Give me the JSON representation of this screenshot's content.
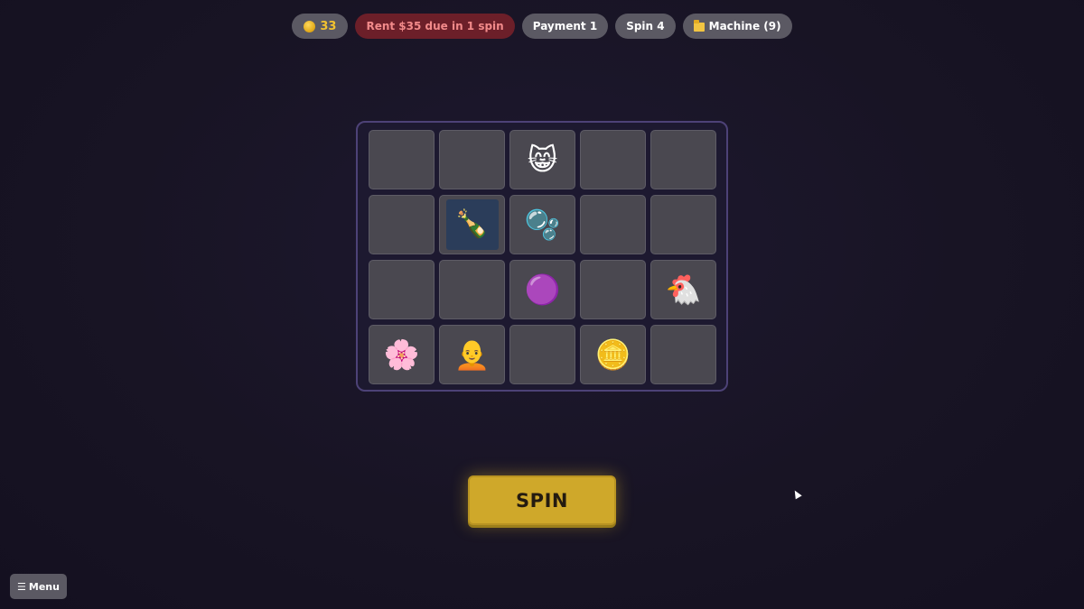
{
  "status": {
    "coins": "33",
    "rent": "Rent $35 due in 1 spin",
    "payment": "Payment 1",
    "spin": "Spin 4",
    "machine": "Machine (9)"
  },
  "icons": {
    "coin": "coin-icon",
    "folder": "folder-icon",
    "menu": "hamburger-icon"
  },
  "colors": {
    "coin_text": "#f2c230",
    "rent_bg": "#6c1f29",
    "rent_text": "#f28a8a",
    "spin_button": "#cfa82a",
    "board_border": "#4d4277"
  },
  "grid": [
    [
      "",
      "",
      "😸",
      "",
      ""
    ],
    [
      "",
      "🍾",
      "🫧",
      "",
      ""
    ],
    [
      "",
      "",
      "🟣",
      "",
      "🐔"
    ],
    [
      "🌸",
      "🧑‍🦲",
      "",
      "🪙",
      ""
    ]
  ],
  "grid_names": [
    [
      "empty",
      "empty",
      "cat",
      "empty",
      "empty"
    ],
    [
      "empty",
      "wine-bottle",
      "bubbles",
      "empty",
      "empty"
    ],
    [
      "empty",
      "empty",
      "purple-bubbles",
      "empty",
      "chicken"
    ],
    [
      "flower",
      "bald-man",
      "empty",
      "coin",
      "empty"
    ]
  ],
  "spin_label": "SPIN",
  "menu_label": "Menu",
  "menu_glyph": "☰"
}
